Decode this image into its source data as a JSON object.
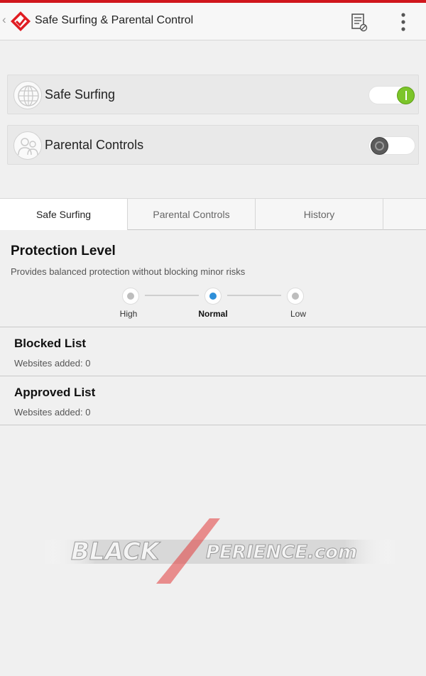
{
  "app": {
    "title": "Safe Surfing & Parental Control"
  },
  "features": [
    {
      "label": "Safe Surfing",
      "enabled": true,
      "icon": "globe-icon"
    },
    {
      "label": "Parental Controls",
      "enabled": false,
      "icon": "family-icon"
    }
  ],
  "tabs": [
    {
      "label": "Safe Surfing",
      "selected": true
    },
    {
      "label": "Parental Controls",
      "selected": false
    },
    {
      "label": "History",
      "selected": false
    }
  ],
  "protection": {
    "title": "Protection Level",
    "description": "Provides balanced protection without blocking minor risks",
    "levels": [
      "High",
      "Normal",
      "Low"
    ],
    "selected": "Normal"
  },
  "lists": [
    {
      "title": "Blocked List",
      "subtitle": "Websites added: 0"
    },
    {
      "title": "Approved List",
      "subtitle": "Websites added: 0"
    }
  ],
  "watermark": {
    "text": "BLACKXPERIENCE.com"
  },
  "colors": {
    "accent": "#d0161c",
    "toggle_on": "#7cc52a",
    "radio_selected": "#2e8fd9"
  }
}
